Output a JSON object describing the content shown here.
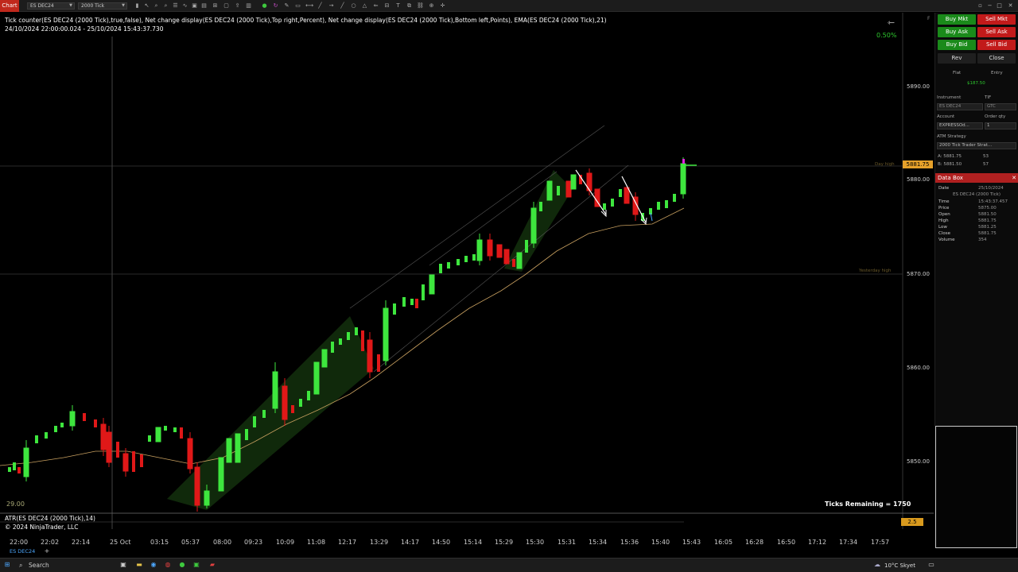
{
  "window": {
    "tab_label": "Chart",
    "instrument_select": "ES DEC24",
    "interval_select": "2000 Tick"
  },
  "chart": {
    "header": "Tick counter(ES DEC24 (2000 Tick),true,false), Net change display(ES DEC24 (2000 Tick),Top right,Percent), Net change display(ES DEC24 (2000 Tick),Bottom left,Points), EMA(ES DEC24 (2000 Tick),21)",
    "date_range": "24/10/2024 22:00:00.024 - 25/10/2024 15:43:37.730",
    "net_change_percent": "0.50%",
    "price_axis": [
      "5890.00",
      "5880.00",
      "5870.00",
      "5860.00",
      "5850.00"
    ],
    "current_price": "5881.75",
    "day_high_label": "Day high",
    "yesterday_high_label": "Yesterday high",
    "ticks_remaining": "Ticks Remaining = 1750",
    "lower_value": "29.00",
    "indicator_label": "ATR(ES DEC24 (2000 Tick),14)",
    "copyright": "© 2024 NinjaTrader, LLC",
    "atr_value": "2.5",
    "x_labels": [
      "22:00",
      "22:02",
      "22:14",
      "25 Oct",
      "03:15",
      "05:37",
      "08:00",
      "09:23",
      "10:09",
      "11:08",
      "12:17",
      "13:29",
      "14:17",
      "14:50",
      "15:14",
      "15:29",
      "15:30",
      "15:31",
      "15:34",
      "15:36",
      "15:40",
      "15:43",
      "16:05",
      "16:28",
      "16:50",
      "17:12",
      "17:34",
      "17:57"
    ],
    "instrument_tab": "ES DEC24",
    "colors": {
      "up": "#3ee63e",
      "down": "#e01818",
      "ema": "#c8a060",
      "channel": "#1e4a14",
      "accent": "#e6a12a"
    }
  },
  "panel": {
    "buy_mkt": "Buy Mkt",
    "sell_mkt": "Sell Mkt",
    "buy_ask": "Buy Ask",
    "sell_ask": "Sell Ask",
    "buy_bid": "Buy Bid",
    "sell_bid": "Sell Bid",
    "rev": "Rev",
    "close": "Close",
    "flat": "Flat",
    "entry": "Entry",
    "pnl": "$187.50",
    "instrument_label": "Instrument",
    "tif_label": "TIF",
    "instrument_value": "ES DEC24",
    "tif_value": "GTC",
    "account_label": "Account",
    "order_qty_label": "Order qty",
    "account_value": "EXPRESSOd...",
    "order_qty_value": "1",
    "atm_label": "ATM Strategy",
    "atm_value": "2000 Tick Trader Strat...",
    "ask_label": "A: 5881.75",
    "ask_size": "53",
    "bid_label": "B: 5881.50",
    "bid_size": "57",
    "databox_title": "Data Box",
    "databox": {
      "date_label": "Date",
      "date": "25/10/2024",
      "instrument": "ES DEC24 (2000 Tick)",
      "rows": [
        {
          "k": "Time",
          "v": "15:43:37.457"
        },
        {
          "k": "Price",
          "v": "5875.00"
        },
        {
          "k": "Open",
          "v": "5881.50"
        },
        {
          "k": "High",
          "v": "5881.75"
        },
        {
          "k": "Low",
          "v": "5881.25"
        },
        {
          "k": "Close",
          "v": "5881.75"
        },
        {
          "k": "Volume",
          "v": "354"
        }
      ]
    }
  },
  "taskbar": {
    "search": "Search",
    "weather": "10°C  Skyet"
  }
}
